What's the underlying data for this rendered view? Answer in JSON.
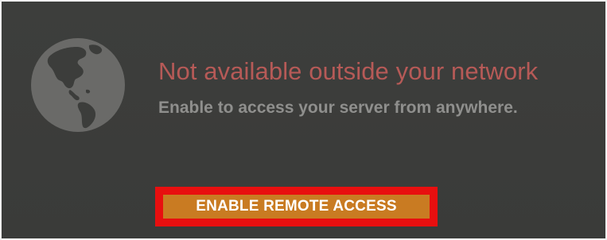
{
  "remote_access": {
    "icon": "globe-icon",
    "headline": "Not available outside your network",
    "subline": "Enable to access your server from anywhere.",
    "button_label": "ENABLE REMOTE ACCESS"
  },
  "colors": {
    "panel_background": "#3b3c3a",
    "headline": "#b65a57",
    "subline": "#8f8f8d",
    "button": "#c97b22",
    "highlight": "#e80f0f"
  }
}
